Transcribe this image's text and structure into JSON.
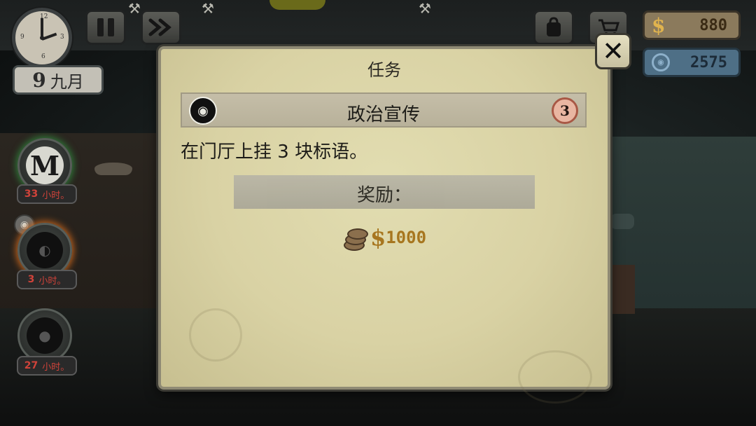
{
  "hud": {
    "date_day": "9",
    "date_month": "九月",
    "money": "880",
    "money_symbol": "$",
    "reputation": "2575",
    "icons": [
      "clock-icon",
      "pause-icon",
      "fast-forward-icon",
      "bag-icon",
      "cart-icon",
      "reputation-icon",
      "hammer-icon"
    ]
  },
  "characters": [
    {
      "initial": "M",
      "timer_value": "33",
      "timer_unit": "小时。",
      "glow": "#2f7d3a"
    },
    {
      "initial": "",
      "timer_value": "3",
      "timer_unit": "小时。",
      "glow": "#c6651d"
    },
    {
      "initial": "",
      "timer_value": "27",
      "timer_unit": "小时。",
      "glow": "none"
    }
  ],
  "dialog": {
    "title": "任务",
    "quest_name": "政治宣传",
    "quest_level": "3",
    "quest_description": "在门厅上挂 3 块标语。",
    "reward_label": "奖励：",
    "reward_symbol": "$",
    "reward_amount": "1000",
    "close_label": "✕"
  },
  "colors": {
    "dialog_bg": "#d9d2a4",
    "reward_gold": "#a7761f",
    "timer_red": "#d0433a",
    "money_panel": "#8b7a5c",
    "reputation_panel": "#4e6f86"
  }
}
